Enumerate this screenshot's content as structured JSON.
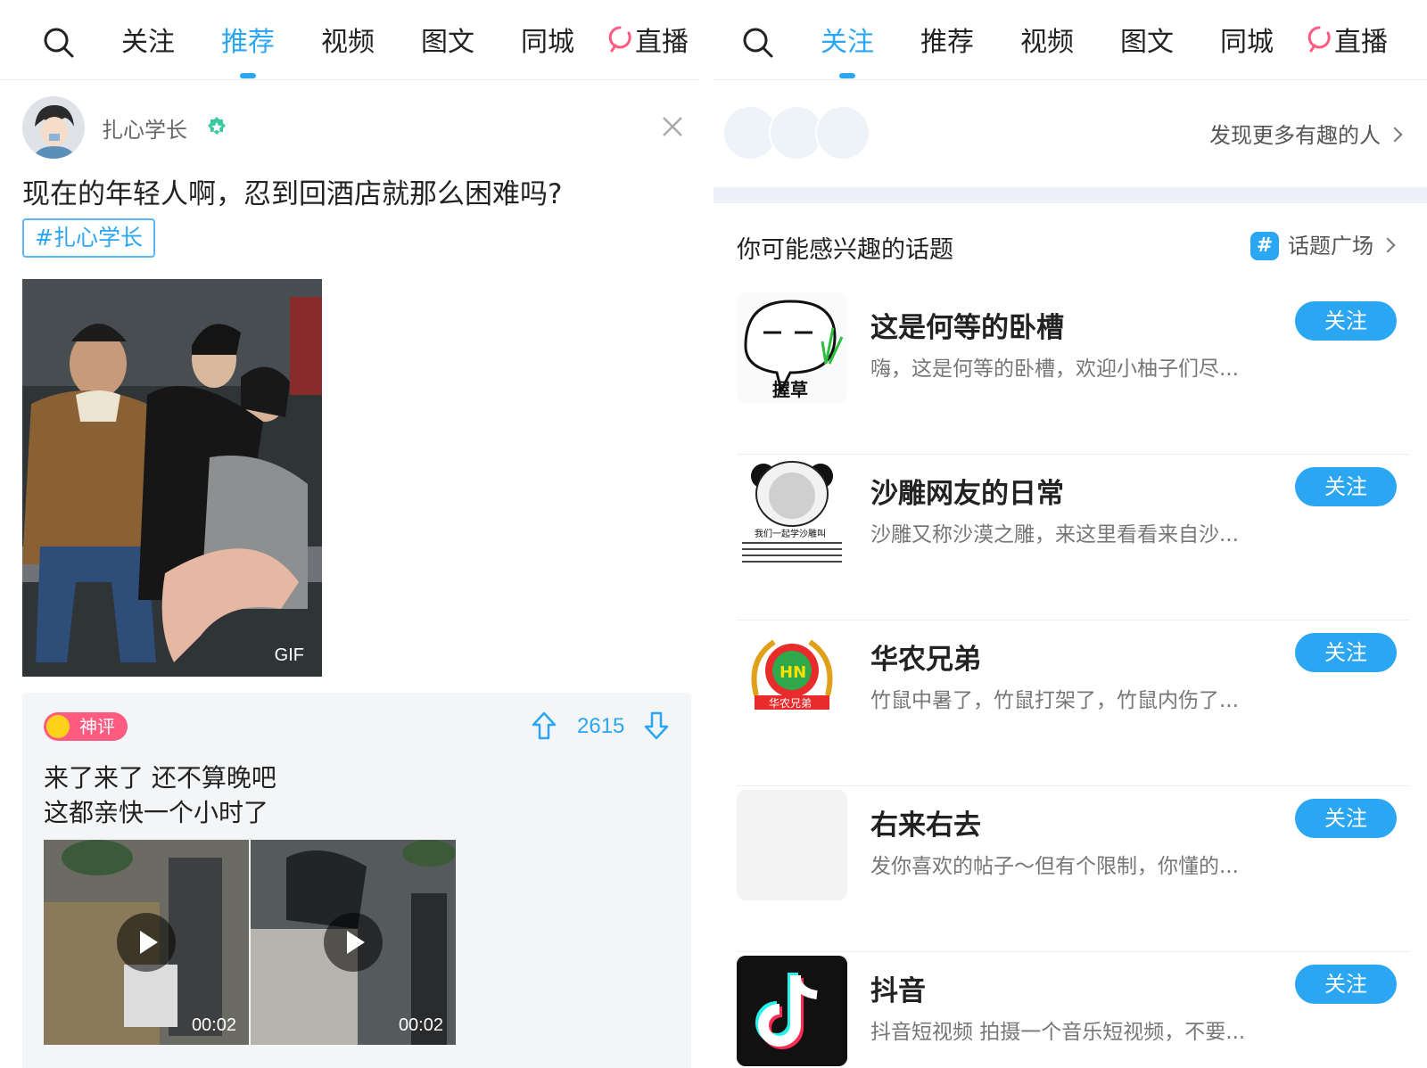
{
  "left": {
    "nav": {
      "tabs": [
        "关注",
        "推荐",
        "视频",
        "图文",
        "同城",
        "直播"
      ],
      "active": "推荐"
    },
    "post": {
      "author": "扎心学长",
      "title": "现在的年轻人啊，忍到回酒店就那么困难吗?",
      "tag": "#扎心学长",
      "image_label": "GIF"
    },
    "comment": {
      "badge": "神评",
      "votes": "2615",
      "lines": [
        "来了来了  还不算晚吧",
        "这都亲快一个小时了"
      ],
      "videos": [
        {
          "duration": "00:02"
        },
        {
          "duration": "00:02"
        }
      ]
    }
  },
  "right": {
    "nav": {
      "tabs": [
        "关注",
        "推荐",
        "视频",
        "图文",
        "同城",
        "直播"
      ],
      "active": "关注"
    },
    "discover_more": "发现更多有趣的人",
    "section_title": "你可能感兴趣的话题",
    "topic_square": "话题广场",
    "topics": [
      {
        "name": "这是何等的卧槽",
        "desc": "嗨，这是何等的卧槽，欢迎小柚子们尽...",
        "button": "关注",
        "thumb_text": "握草"
      },
      {
        "name": "沙雕网友的日常",
        "desc": "沙雕又称沙漠之雕，来这里看看来自沙...",
        "button": "关注",
        "thumb_text": "我们一起学沙雕叫"
      },
      {
        "name": "华农兄弟",
        "desc": "竹鼠中暑了，竹鼠打架了，竹鼠内伤了...",
        "button": "关注",
        "thumb_text": "华农兄弟"
      },
      {
        "name": "右来右去",
        "desc": "发你喜欢的帖子～但有个限制，你懂的...",
        "button": "关注",
        "thumb_text": ""
      },
      {
        "name": "抖音",
        "desc": "抖音短视频 拍摄一个音乐短视频，不要...",
        "button": "关注",
        "thumb_text": ""
      }
    ]
  },
  "colors": {
    "accent": "#2aa6f3",
    "badge": "#ff5a7f",
    "band": "#eef0f7",
    "live": "#ff5a7f"
  },
  "icons": [
    "search-icon",
    "live-icon",
    "verified-icon",
    "close-icon",
    "arrow-up-icon",
    "arrow-down-icon",
    "play-icon",
    "chevron-right-icon",
    "hash-icon"
  ]
}
